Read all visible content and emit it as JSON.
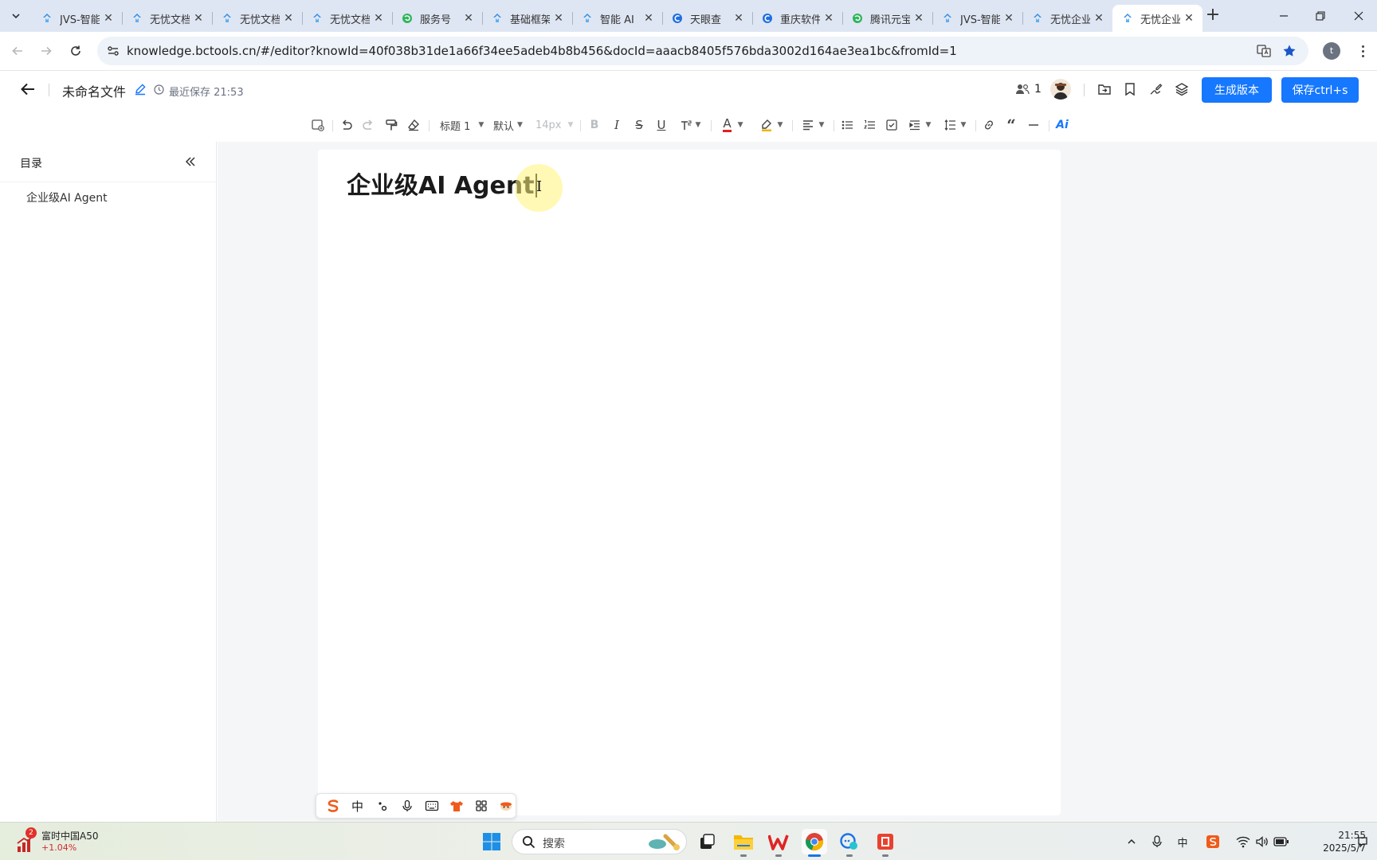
{
  "browser": {
    "tabs": [
      {
        "title": "JVS-智能",
        "favicon": "jvs-icon"
      },
      {
        "title": "无忧文档",
        "favicon": "jvs-icon"
      },
      {
        "title": "无忧文档",
        "favicon": "jvs-icon"
      },
      {
        "title": "无忧文档",
        "favicon": "jvs-icon"
      },
      {
        "title": "服务号",
        "favicon": "green-swirl-icon"
      },
      {
        "title": "基础框架",
        "favicon": "jvs-icon"
      },
      {
        "title": "智能 AI",
        "favicon": "jvs-icon"
      },
      {
        "title": "天眼查",
        "favicon": "blue-c-icon"
      },
      {
        "title": "重庆软件",
        "favicon": "blue-c-icon"
      },
      {
        "title": "腾讯元宝",
        "favicon": "green-swirl-icon"
      },
      {
        "title": "JVS-智能",
        "favicon": "jvs-icon"
      },
      {
        "title": "无忧企业",
        "favicon": "jvs-icon"
      },
      {
        "title": "无忧企业",
        "favicon": "jvs-icon",
        "active": true
      }
    ],
    "tab_close_glyph": "✕",
    "new_tab_glyph": "+",
    "url": "knowledge.bctools.cn/#/editor?knowId=40f038b31de1a66f34ee5adeb4b8b456&docId=aaacb8405f576bda3002d164ae3ea1bc&fromId=1",
    "profile_initial": "t"
  },
  "header": {
    "doc_title": "未命名文件",
    "save_status": "最近保存 21:53",
    "collaborator_count": "1",
    "generate_version_label": "生成版本",
    "save_label": "保存ctrl+s"
  },
  "format_toolbar": {
    "heading_select": "标题 1",
    "font_select": "默认",
    "size_select": "14px",
    "bold": "B",
    "italic": "I",
    "strike": "S",
    "underline": "U",
    "text_color": "A",
    "ai_label": "Ai"
  },
  "sidebar": {
    "title": "目录",
    "items": [
      "企业级AI Agent"
    ]
  },
  "document": {
    "heading": "企业级AI Agent"
  },
  "ime_bar": {
    "mode": "中"
  },
  "taskbar": {
    "stock_badge": "2",
    "stock_name": "富时中国A50",
    "stock_change": "+1.04%",
    "search_placeholder": "搜索",
    "ime_indicator": "中",
    "time": "21:55",
    "date": "2025/5/7"
  },
  "colors": {
    "accent": "#1677ff",
    "tabstrip": "#dfe6f3",
    "canvas": "#f5f6f8",
    "cursor_halo": "#fff478"
  }
}
